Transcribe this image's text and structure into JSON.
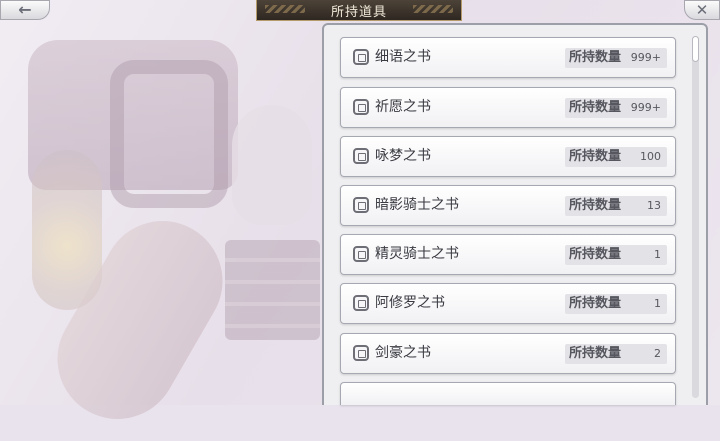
{
  "header": {
    "title": "所持道具",
    "back_icon": "←",
    "close_icon": "✕"
  },
  "list": {
    "qty_label": "所持数量",
    "items": [
      {
        "name": "细语之书",
        "qty": "999+"
      },
      {
        "name": "祈愿之书",
        "qty": "999+"
      },
      {
        "name": "咏梦之书",
        "qty": "100"
      },
      {
        "name": "暗影骑士之书",
        "qty": "13"
      },
      {
        "name": "精灵骑士之书",
        "qty": "1"
      },
      {
        "name": "阿修罗之书",
        "qty": "1"
      },
      {
        "name": "剑豪之书",
        "qty": "2"
      }
    ]
  }
}
